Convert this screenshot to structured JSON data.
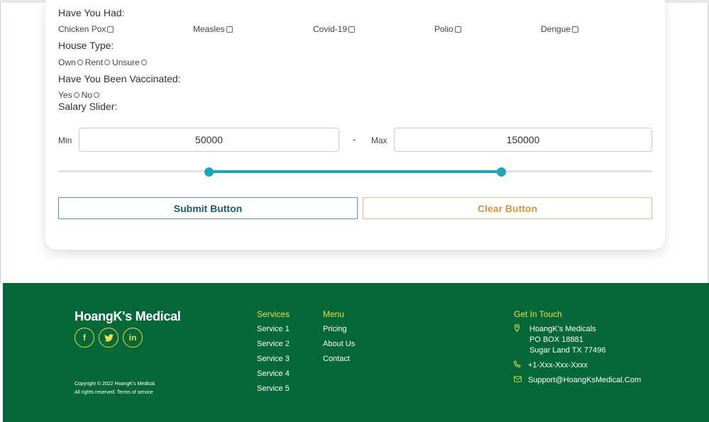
{
  "form": {
    "had_title": "Have You Had:",
    "diseases": [
      "Chicken Pox",
      "Measles",
      "Covid-19",
      "Polio",
      "Dengue"
    ],
    "house_title": "House Type:",
    "house_options": [
      "Own",
      "Rent",
      "Unsure"
    ],
    "vaccinated_title": "Have You Been Vaccinated:",
    "vaccinated_options": [
      "Yes",
      "No"
    ],
    "salary_title": "Salary Slider:",
    "min_label": "Min",
    "min_value": "50000",
    "dash": "-",
    "max_label": "Max",
    "max_value": "150000",
    "slider": {
      "min_fraction": 0.254,
      "max_fraction": 0.746
    },
    "submit_label": "Submit Button",
    "clear_label": "Clear Button"
  },
  "footer": {
    "brand": "HoangK's Medical",
    "social_icons": [
      "facebook-icon",
      "twitter-icon",
      "linkedin-icon"
    ],
    "social_glyphs": [
      "f",
      "t",
      "in"
    ],
    "copyright_line1": "Copyright © 2022 HoangK's Medical.",
    "copyright_line2": "All rights reserved. Terms of service",
    "services_title": "Services",
    "services": [
      "Service 1",
      "Service 2",
      "Service 3",
      "Service 4",
      "Service 5"
    ],
    "menu_title": "Menu",
    "menu": [
      "Pricing",
      "About Us",
      "Contact"
    ],
    "contact_title": "Get In Touch",
    "address_line1": "HoangK's Medicals",
    "address_line2": "PO BOX 18881",
    "address_line3": "Sugar Land TX 77496",
    "phone": "+1-Xxx-Xxx-Xxxx",
    "email": "Support@HoangKsMedical.Com"
  },
  "colors": {
    "accent": "#1fa3b8",
    "footer_bg": "#066838",
    "footer_accent": "#e6e04a",
    "clear_button": "#c89a40"
  }
}
